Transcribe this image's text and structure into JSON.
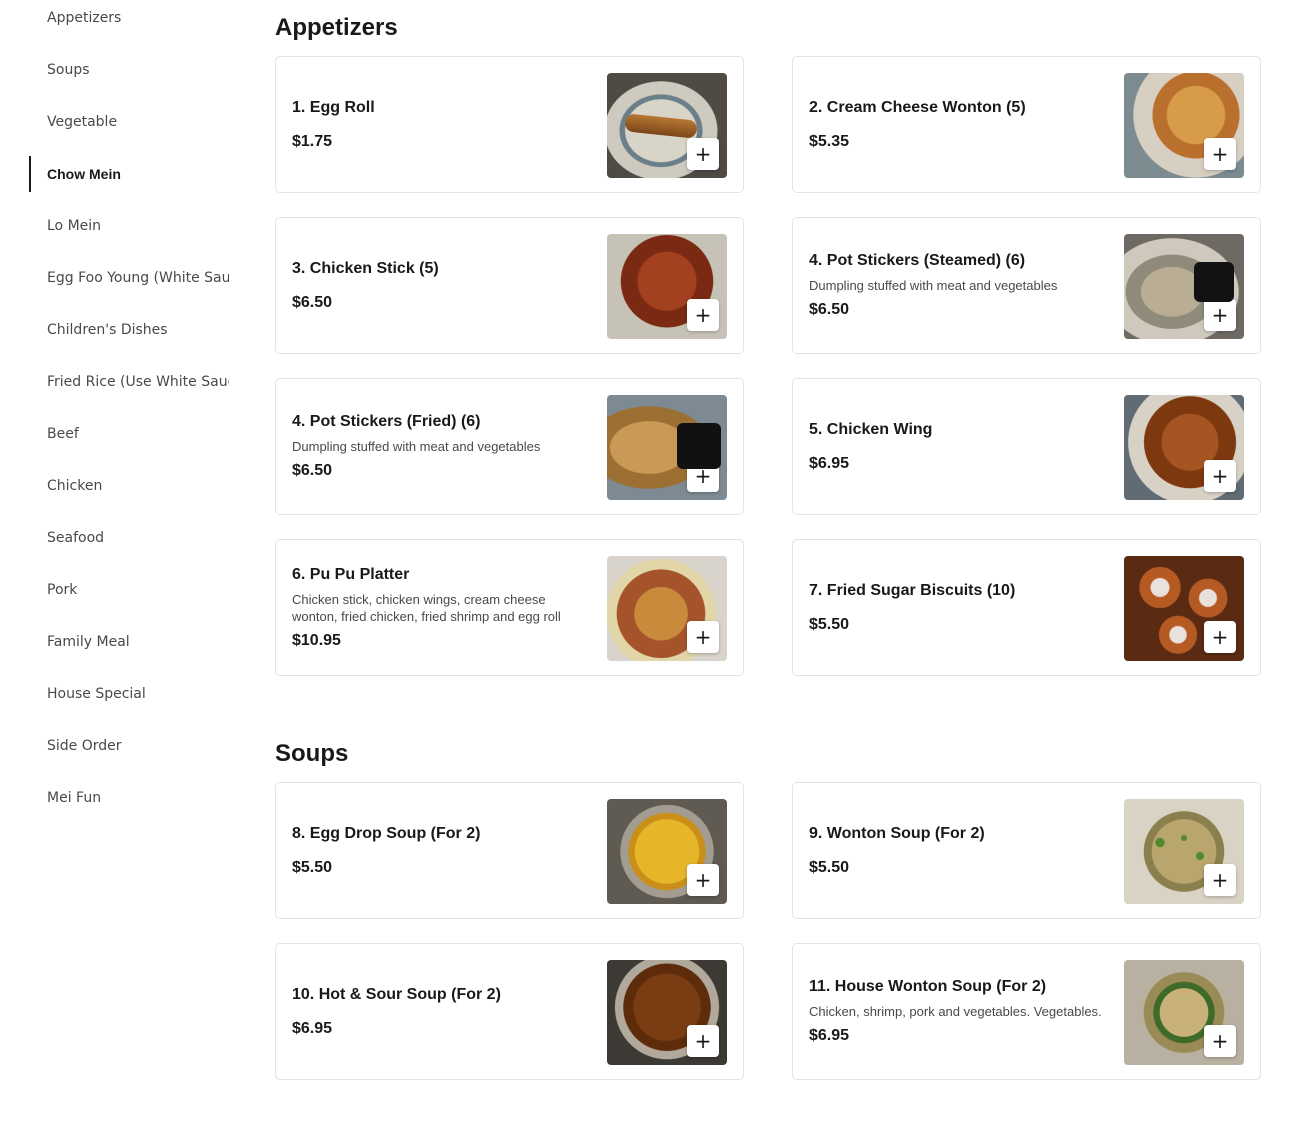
{
  "sidebar": {
    "items": [
      {
        "label": "Appetizers",
        "active": false
      },
      {
        "label": "Soups",
        "active": false
      },
      {
        "label": "Vegetable",
        "active": false
      },
      {
        "label": "Chow Mein",
        "active": true
      },
      {
        "label": "Lo Mein",
        "active": false
      },
      {
        "label": "Egg Foo Young (White Sau",
        "active": false
      },
      {
        "label": "Children's Dishes",
        "active": false
      },
      {
        "label": "Fried Rice (Use White Sauc",
        "active": false
      },
      {
        "label": "Beef",
        "active": false
      },
      {
        "label": "Chicken",
        "active": false
      },
      {
        "label": "Seafood",
        "active": false
      },
      {
        "label": "Pork",
        "active": false
      },
      {
        "label": "Family Meal",
        "active": false
      },
      {
        "label": "House Special",
        "active": false
      },
      {
        "label": "Side Order",
        "active": false
      },
      {
        "label": "Mei Fun",
        "active": false
      }
    ]
  },
  "sections": [
    {
      "title": "Appetizers",
      "items": [
        {
          "name": "1. Egg Roll",
          "description": "",
          "price": "$1.75",
          "image": "egg-roll-image"
        },
        {
          "name": "2. Cream Cheese Wonton (5)",
          "description": "",
          "price": "$5.35",
          "image": "cream-cheese-wonton-image"
        },
        {
          "name": "3. Chicken Stick (5)",
          "description": "",
          "price": "$6.50",
          "image": "chicken-stick-image"
        },
        {
          "name": "4. Pot Stickers (Steamed) (6)",
          "description": "Dumpling stuffed with meat and vegetables",
          "price": "$6.50",
          "image": "pot-stickers-steamed-image"
        },
        {
          "name": "4. Pot Stickers (Fried) (6)",
          "description": "Dumpling stuffed with meat and vegetables",
          "price": "$6.50",
          "image": "pot-stickers-fried-image"
        },
        {
          "name": "5. Chicken Wing",
          "description": "",
          "price": "$6.95",
          "image": "chicken-wing-image"
        },
        {
          "name": "6. Pu Pu Platter",
          "description": "Chicken stick, chicken wings, cream cheese wonton, fried chicken, fried shrimp and egg roll",
          "price": "$10.95",
          "image": "pu-pu-platter-image"
        },
        {
          "name": "7. Fried Sugar Biscuits (10)",
          "description": "",
          "price": "$5.50",
          "image": "fried-sugar-biscuits-image"
        }
      ]
    },
    {
      "title": "Soups",
      "items": [
        {
          "name": "8. Egg Drop Soup (For 2)",
          "description": "",
          "price": "$5.50",
          "image": "egg-drop-soup-image"
        },
        {
          "name": "9. Wonton Soup (For 2)",
          "description": "",
          "price": "$5.50",
          "image": "wonton-soup-image"
        },
        {
          "name": "10. Hot & Sour Soup (For 2)",
          "description": "",
          "price": "$6.95",
          "image": "hot-sour-soup-image"
        },
        {
          "name": "11. House Wonton Soup (For 2)",
          "description": "Chicken, shrimp, pork and vegetables. Vegetables.",
          "price": "$6.95",
          "image": "house-wonton-soup-image"
        }
      ]
    }
  ],
  "add_button": {
    "label": "+",
    "icon": "plus-icon"
  },
  "colors": {
    "text": "#191919",
    "muted": "#494949",
    "border": "#e4e4e4",
    "background": "#ffffff"
  }
}
